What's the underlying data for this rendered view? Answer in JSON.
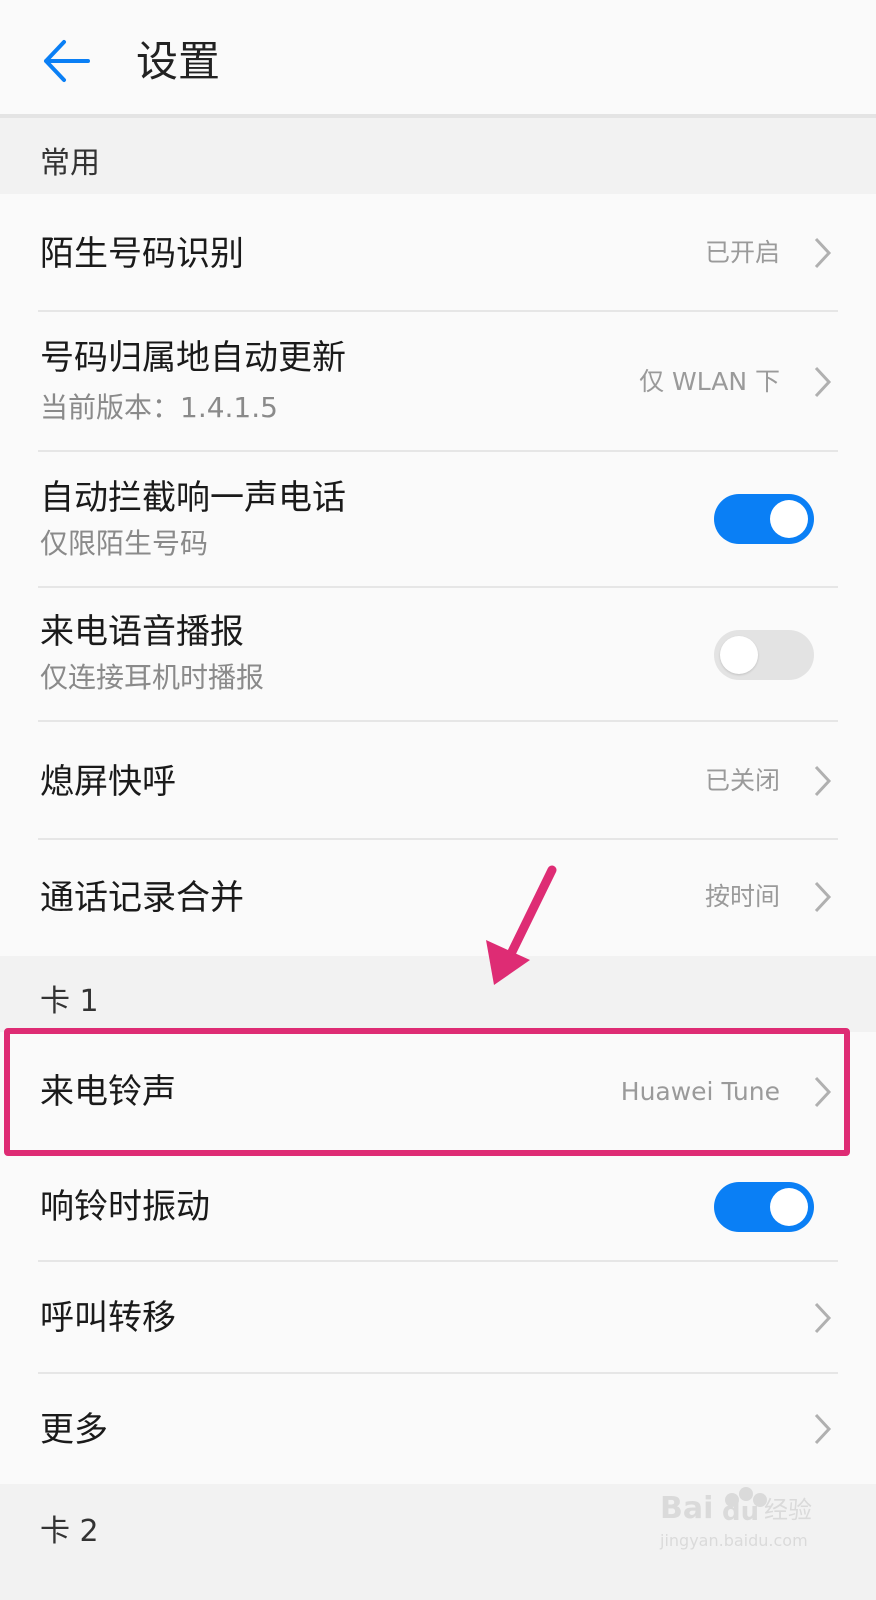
{
  "header": {
    "title": "设置",
    "back_icon": "arrow-left-icon"
  },
  "sections": [
    {
      "label": "常用",
      "items": [
        {
          "title": "陌生号码识别",
          "value": "已开启",
          "control": "chevron"
        },
        {
          "title": "号码归属地自动更新",
          "subtitle": "当前版本：1.4.1.5",
          "value": "仅 WLAN 下",
          "control": "chevron"
        },
        {
          "title": "自动拦截响一声电话",
          "subtitle": "仅限陌生号码",
          "control": "toggle",
          "toggle_on": true
        },
        {
          "title": "来电语音播报",
          "subtitle": "仅连接耳机时播报",
          "control": "toggle",
          "toggle_on": false
        },
        {
          "title": "熄屏快呼",
          "value": "已关闭",
          "control": "chevron"
        },
        {
          "title": "通话记录合并",
          "value": "按时间",
          "control": "chevron"
        }
      ]
    },
    {
      "label": "卡 1",
      "items": [
        {
          "title": "来电铃声",
          "value": "Huawei Tune",
          "control": "chevron",
          "highlighted": true
        },
        {
          "title": "响铃时振动",
          "control": "toggle",
          "toggle_on": true
        },
        {
          "title": "呼叫转移",
          "control": "chevron"
        },
        {
          "title": "更多",
          "control": "chevron"
        }
      ]
    },
    {
      "label": "卡 2",
      "items": []
    }
  ],
  "watermark": {
    "brand": "Baidu经验",
    "url": "jingyan.baidu.com"
  },
  "colors": {
    "accent": "#0a7ff5",
    "annotation": "#de2c74",
    "toggle_off": "#e3e3e3"
  }
}
